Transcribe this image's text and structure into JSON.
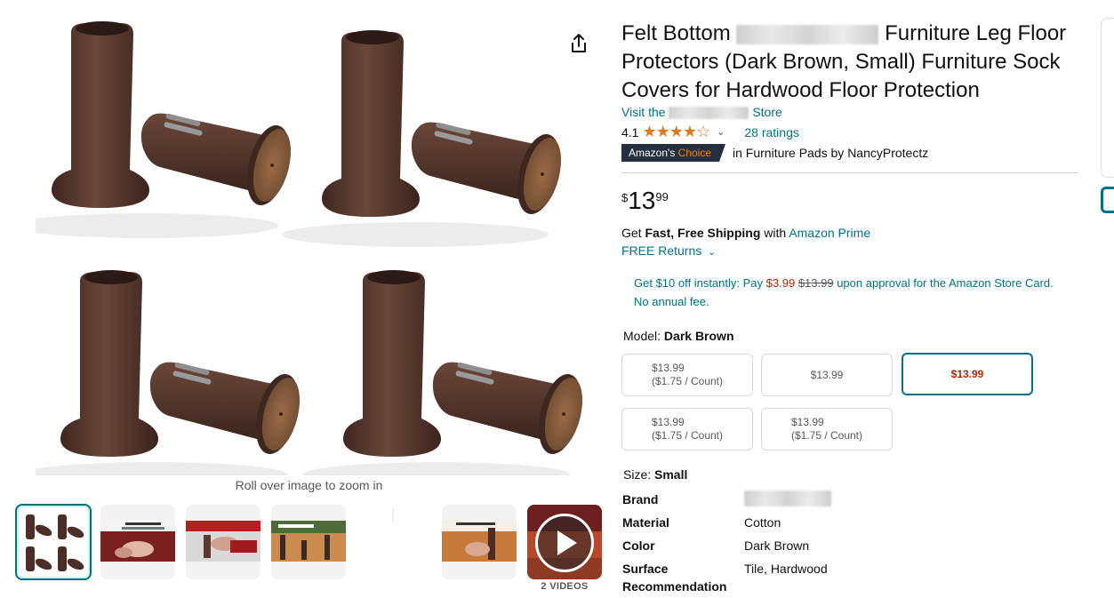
{
  "gallery": {
    "zoom_hint": "Roll over image to zoom in",
    "videos_label": "2 VIDEOS",
    "thumb_icons": [
      "product-thumbnail",
      "feature-thumbnail",
      "usage-thumbnail",
      "room-thumbnail",
      "blank-thumbnail",
      "chair-thumbnail",
      "video-thumbnail"
    ]
  },
  "product": {
    "title_a": "Felt Bottom",
    "title_b": "Furniture Leg Floor Protectors (Dark Brown, Small) Furniture Sock Covers for Hardwood Floor Protection",
    "store_prefix": "Visit the",
    "store_suffix": "Store",
    "rating_value": "4.1",
    "stars": "★★★★☆",
    "ratings_count": "28 ratings",
    "badge_a": "Amazon's",
    "badge_b": "Choice",
    "badge_context": "in Furniture Pads by NancyProtectz",
    "price_currency": "$",
    "price_whole": "13",
    "price_fraction": "99"
  },
  "shipping": {
    "get": "Get",
    "fast": "Fast, Free Shipping",
    "with": "with",
    "prime": "Amazon Prime",
    "returns": "FREE Returns",
    "returns_chevron": "⌄"
  },
  "promo": {
    "p1": "Get $10 off instantly: Pay",
    "pay_price": "$3.99",
    "orig_price": "$13.99",
    "p2": "upon approval for the Amazon Store Card.",
    "p3": "No annual fee."
  },
  "model": {
    "label": "Model:",
    "value": "Dark Brown",
    "options": [
      {
        "price": "$13.99",
        "unit": "($1.75 / Count)"
      },
      {
        "price": "$13.99",
        "unit": ""
      },
      {
        "price": "$13.99",
        "unit": ""
      },
      {
        "price": "$13.99",
        "unit": "($1.75 / Count)"
      },
      {
        "price": "$13.99",
        "unit": "($1.75 / Count)"
      }
    ]
  },
  "size": {
    "label": "Size:",
    "value": "Small"
  },
  "specs": [
    {
      "key": "Brand",
      "value": ""
    },
    {
      "key": "Material",
      "value": "Cotton"
    },
    {
      "key": "Color",
      "value": "Dark Brown"
    },
    {
      "key": "Surface",
      "value": "Tile, Hardwood"
    },
    {
      "key": "Recommendation",
      "value": ""
    }
  ],
  "colors": {
    "link": "#007185",
    "price_red": "#b12704",
    "badge_bg": "#232f3e",
    "star": "#de7921",
    "felt": "#5a3a2e"
  }
}
